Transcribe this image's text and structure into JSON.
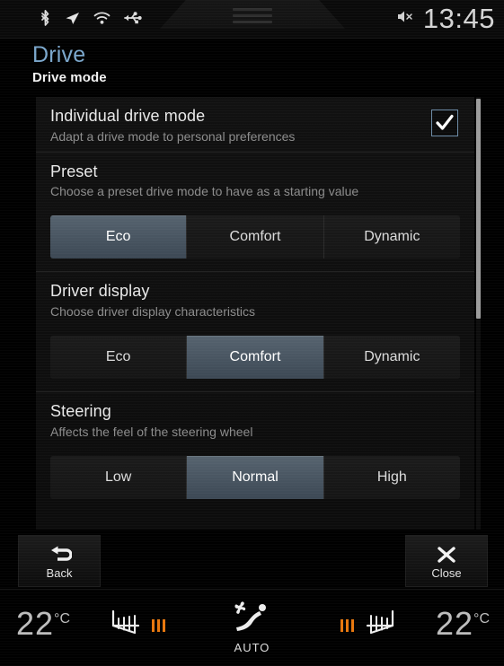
{
  "status_bar": {
    "icons": [
      "bluetooth-icon",
      "navigation-arrow-icon",
      "wifi-icon",
      "usb-icon"
    ],
    "menu_icon": "hamburger-menu-icon",
    "mute_icon": "mute-icon",
    "clock": "13:45"
  },
  "header": {
    "title": "Drive",
    "subtitle": "Drive mode",
    "title_color": "#7ba7cc"
  },
  "settings": {
    "rows": [
      {
        "title": "Individual drive mode",
        "description": "Adapt a drive mode to personal preferences",
        "checkbox": true,
        "checkbox_icon": "checkmark-icon"
      },
      {
        "title": "Preset",
        "description": "Choose a preset drive mode to have as a starting value",
        "options": [
          "Eco",
          "Comfort",
          "Dynamic"
        ],
        "selected": "Eco"
      },
      {
        "title": "Driver display",
        "description": "Choose driver display characteristics",
        "options": [
          "Eco",
          "Comfort",
          "Dynamic"
        ],
        "selected": "Comfort"
      },
      {
        "title": "Steering",
        "description": "Affects the feel of the steering wheel",
        "options": [
          "Low",
          "Normal",
          "High"
        ],
        "selected": "Normal"
      }
    ],
    "selected_color": "#4a5663"
  },
  "bottom_bar": {
    "back_label": "Back",
    "back_icon": "back-arrow-icon",
    "close_label": "Close",
    "close_icon": "close-x-icon"
  },
  "climate_bar": {
    "left_temperature": "22",
    "left_unit": "°C",
    "right_temperature": "22",
    "right_unit": "°C",
    "left_seat_icon": "seat-heater-icon",
    "right_seat_icon": "seat-heater-icon",
    "left_seat_level": 3,
    "right_seat_level": 3,
    "seat_level_color": "#e8770d",
    "auto_label": "AUTO",
    "auto_icon": "climate-auto-icon"
  }
}
